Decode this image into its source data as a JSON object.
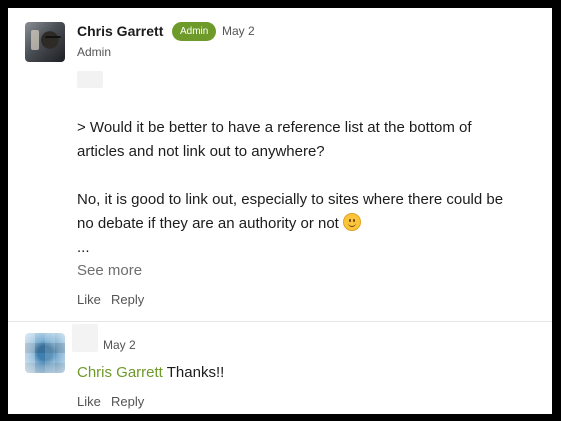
{
  "comments": [
    {
      "author": "Chris Garrett",
      "badge": "Admin",
      "date": "May 2",
      "role": "Admin",
      "body_lines": [
        "> Would it be better to have a reference list at the bottom of",
        "articles and not link out to anywhere?",
        "No, it is good to link out, especially to sites where there could be",
        "no debate if they are an authority or not",
        "..."
      ],
      "emoji": "slightly-smiling-face-icon",
      "see_more": "See more",
      "like": "Like",
      "reply": "Reply"
    },
    {
      "author": "",
      "date": "May 2",
      "mention": "Chris Garrett",
      "body": " Thanks!!",
      "like": "Like",
      "reply": "Reply"
    }
  ],
  "colors": {
    "accent": "#6e9a2a",
    "text": "#1c1c1c",
    "muted": "#545454"
  }
}
